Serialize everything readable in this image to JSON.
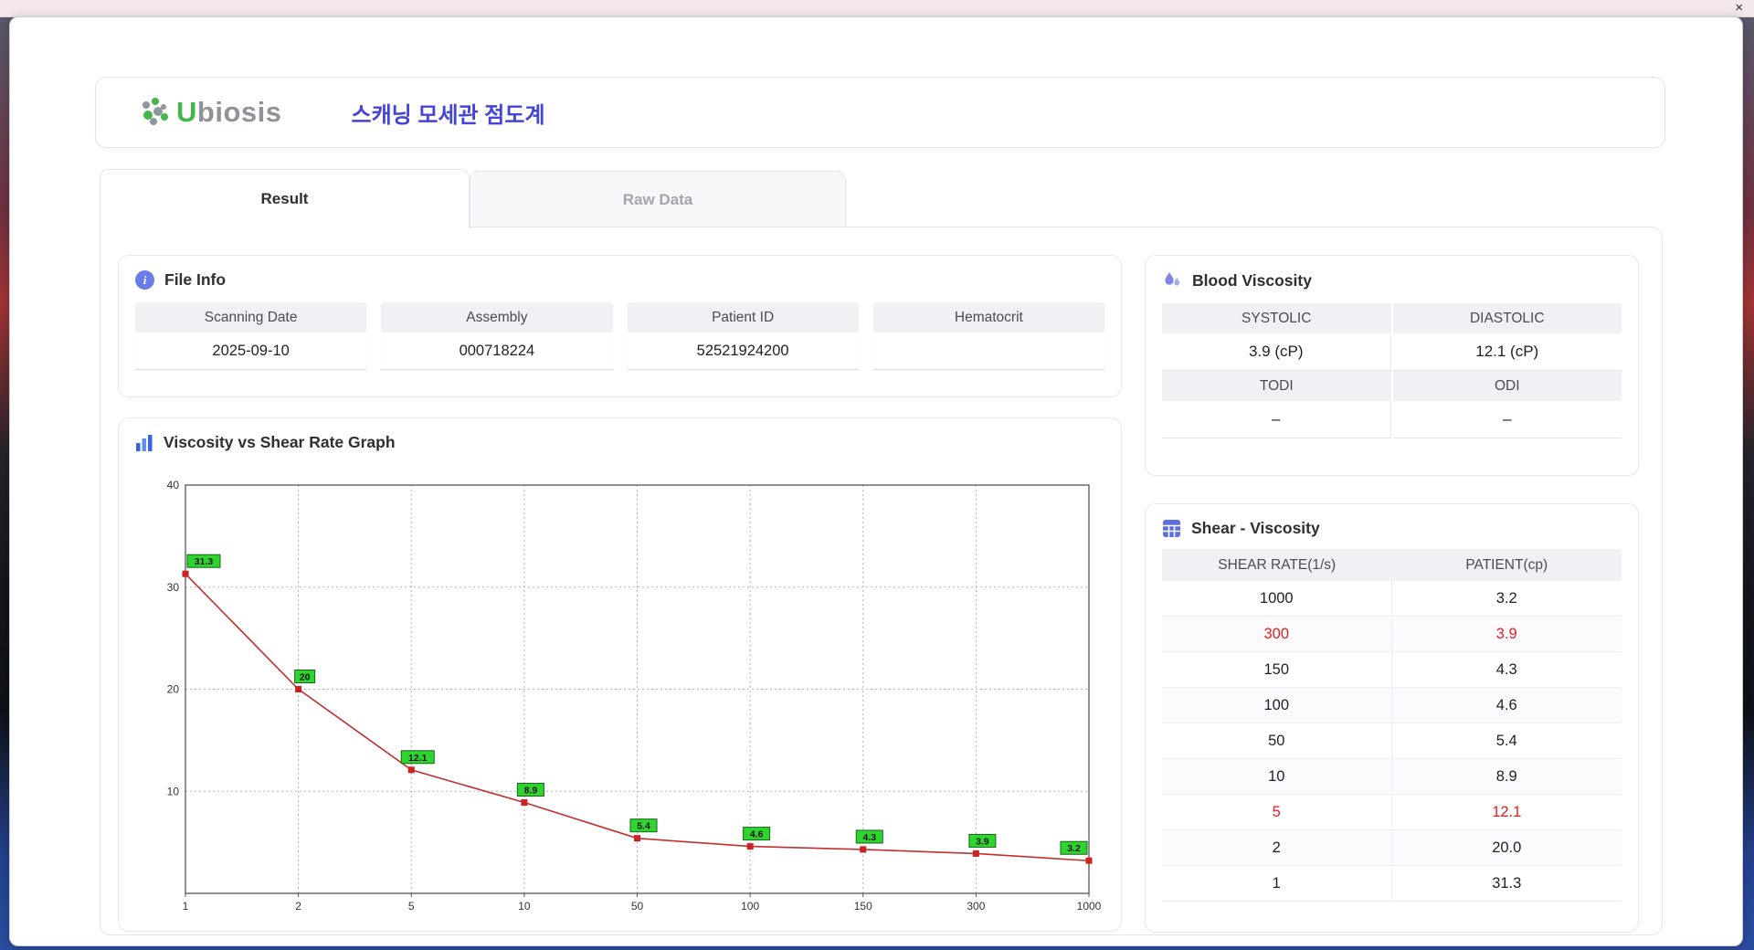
{
  "window": {
    "close_glyph": "×"
  },
  "icons": {
    "info": "i"
  },
  "header": {
    "logo_u": "U",
    "logo_rest": "biosis",
    "app_title": "스캐닝 모세관 점도계"
  },
  "tabs": [
    {
      "label": "Result",
      "active": true
    },
    {
      "label": "Raw Data",
      "active": false
    }
  ],
  "file_info": {
    "title": "File Info",
    "fields": [
      {
        "label": "Scanning Date",
        "value": "2025-09-10"
      },
      {
        "label": "Assembly",
        "value": "000718224"
      },
      {
        "label": "Patient ID",
        "value": "52521924200"
      },
      {
        "label": "Hematocrit",
        "value": ""
      }
    ]
  },
  "blood_viscosity": {
    "title": "Blood Viscosity",
    "rows": [
      {
        "headers": [
          "SYSTOLIC",
          "DIASTOLIC"
        ],
        "values": [
          "3.9 (cP)",
          "12.1 (cP)"
        ]
      },
      {
        "headers": [
          "TODI",
          "ODI"
        ],
        "values": [
          "–",
          "–"
        ]
      }
    ]
  },
  "shear_viscosity": {
    "title": "Shear - Viscosity",
    "columns": [
      "SHEAR RATE(1/s)",
      "PATIENT(cp)"
    ],
    "rows": [
      {
        "rate": "1000",
        "patient": "3.2",
        "highlight": false
      },
      {
        "rate": "300",
        "patient": "3.9",
        "highlight": true
      },
      {
        "rate": "150",
        "patient": "4.3",
        "highlight": false
      },
      {
        "rate": "100",
        "patient": "4.6",
        "highlight": false
      },
      {
        "rate": "50",
        "patient": "5.4",
        "highlight": false
      },
      {
        "rate": "10",
        "patient": "8.9",
        "highlight": false
      },
      {
        "rate": "5",
        "patient": "12.1",
        "highlight": true
      },
      {
        "rate": "2",
        "patient": "20.0",
        "highlight": false
      },
      {
        "rate": "1",
        "patient": "31.3",
        "highlight": false
      }
    ]
  },
  "chart_data": {
    "type": "line",
    "title": "Viscosity vs Shear Rate Graph",
    "x": [
      1,
      2,
      5,
      10,
      50,
      100,
      150,
      300,
      1000
    ],
    "x_tick_labels": [
      "1",
      "2",
      "5",
      "10",
      "50",
      "100",
      "150",
      "300",
      "1000"
    ],
    "values": [
      31.3,
      20,
      12.1,
      8.9,
      5.4,
      4.6,
      4.3,
      3.9,
      3.2
    ],
    "point_labels": [
      "31.3",
      "20",
      "12.1",
      "8.9",
      "5.4",
      "4.6",
      "4.3",
      "3.9",
      "3.2"
    ],
    "xlabel": "",
    "ylabel": "",
    "ylim": [
      0,
      40
    ],
    "y_ticks": [
      10,
      20,
      30,
      40
    ],
    "x_axis_type": "categorical-log-ticks",
    "grid": true,
    "legend": "none",
    "line_color": "#c23030",
    "marker_color": "#cc2222",
    "label_bg": "#2ed52e"
  },
  "colors": {
    "accent_blue": "#4444d8",
    "icon_blue": "#6a7de6",
    "logo_green": "#45b649",
    "logo_gray": "#8f9399",
    "table_header_bg": "#f1f1f5",
    "highlight_red": "#e01f1f"
  }
}
